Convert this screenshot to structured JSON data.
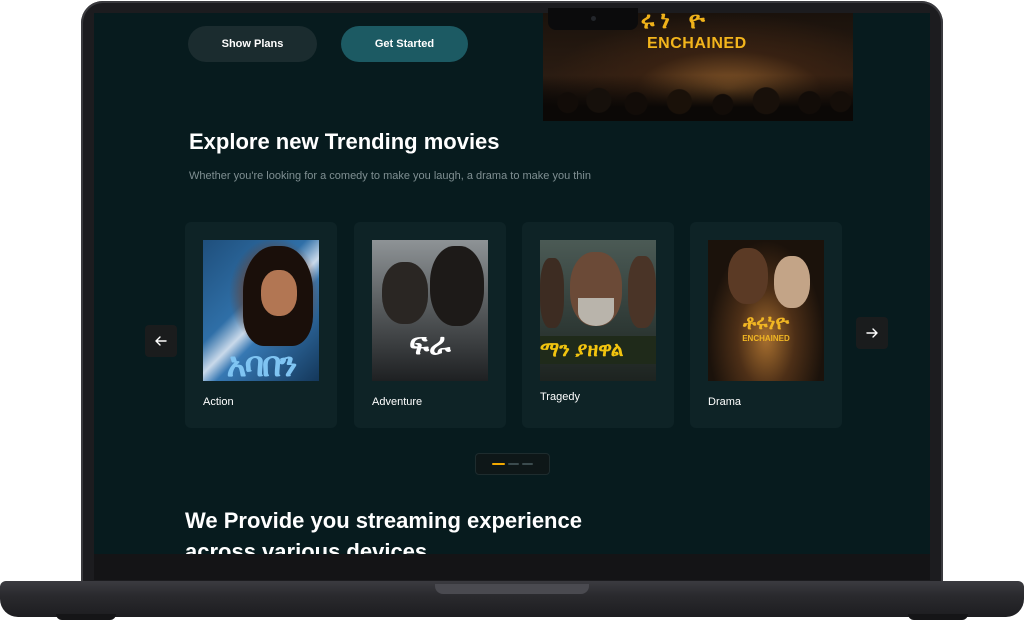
{
  "hero": {
    "show_plans_label": "Show Plans",
    "get_started_label": "Get Started",
    "banner_amharic": "ቶሩነ ዮ",
    "banner_title": "ENCHAINED"
  },
  "trending": {
    "title": "Explore new Trending movies",
    "subtitle": "Whether you're looking for a comedy to make you laugh, a drama to make you thin",
    "prev_icon": "arrow-left-icon",
    "next_icon": "arrow-right-icon",
    "cards": [
      {
        "label": "Action",
        "poster_text": "አባበን"
      },
      {
        "label": "Adventure",
        "poster_text": "ፍራ"
      },
      {
        "label": "Tragedy",
        "poster_text": "ማን ያዘዋል"
      },
      {
        "label": "Drama",
        "poster_text": "ቶሩነዮ",
        "poster_subtext": "ENCHAINED"
      }
    ],
    "pager": {
      "pages": 3,
      "active": 1
    }
  },
  "devices": {
    "title": "We Provide you streaming experience across various devices."
  },
  "colors": {
    "screen_bg": "#071b1e",
    "card_bg": "#0e2326",
    "primary_button": "#1c5a63",
    "accent": "#f2a900"
  }
}
